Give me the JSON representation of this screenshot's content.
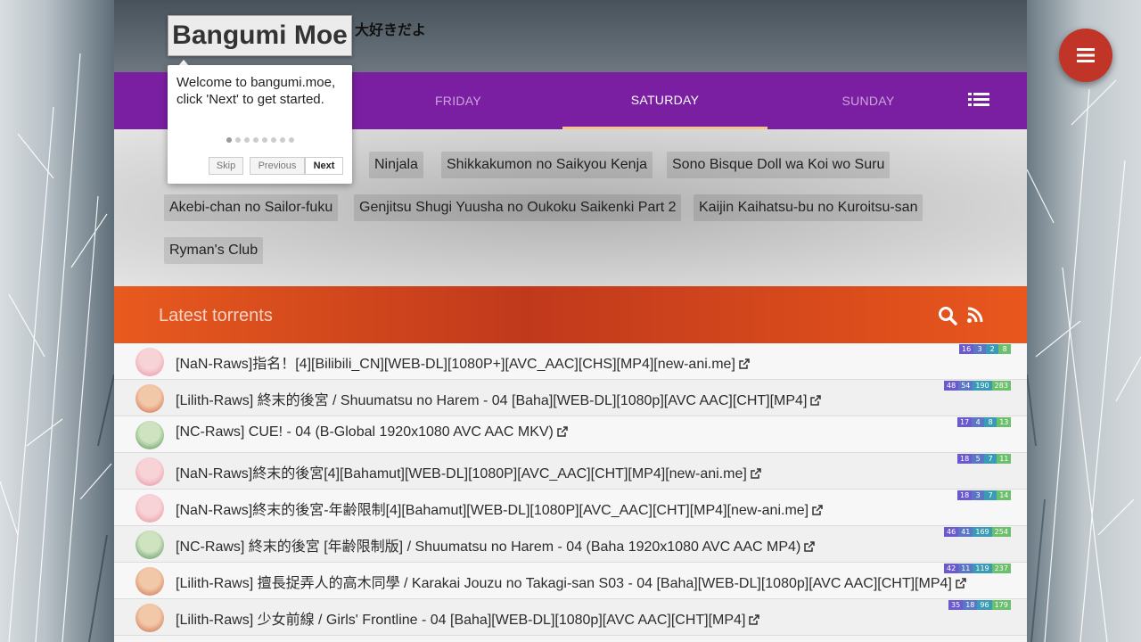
{
  "brand": {
    "logo_text": "Bangumi Moe",
    "tagline": "大好きだよ"
  },
  "days": [
    {
      "label": "FRIDAY",
      "active": false
    },
    {
      "label": "SATURDAY",
      "active": true
    },
    {
      "label": "SUNDAY",
      "active": false
    }
  ],
  "bangumi_tags": [
    "Ninjala",
    "Shikkakumon no Saikyou Kenja",
    "Sono Bisque Doll wa Koi wo Suru",
    "Akebi-chan no Sailor-fuku",
    "Genjitsu Shugi Yuusha no Oukoku Saikenki Part 2",
    "Kaijin Kaihatsu-bu no Kuroitsu-san",
    "Ryman's Club"
  ],
  "torrents": {
    "header_title": "Latest torrents",
    "rows": [
      {
        "title": "[NaN-Raws]指名！[4][Bilibili_CN][WEB-DL][1080P+][AVC_AAC][CHS][MP4][new-ani.me]",
        "avatar": "pink",
        "stats": [
          "16",
          "3",
          "2",
          "8"
        ]
      },
      {
        "title": "[Lilith-Raws] 終末的後宮 / Shuumatsu no Harem - 04 [Baha][WEB-DL][1080p][AVC AAC][CHT][MP4]",
        "avatar": "orange",
        "stats": [
          "48",
          "54",
          "190",
          "283"
        ]
      },
      {
        "title": "[NC-Raws] CUE! - 04 (B-Global 1920x1080 AVC AAC MKV)",
        "avatar": "green",
        "stats": [
          "17",
          "4",
          "8",
          "13"
        ]
      },
      {
        "title": "[NaN-Raws]終末的後宮[4][Bahamut][WEB-DL][1080P][AVC_AAC][CHT][MP4][new-ani.me]",
        "avatar": "pink",
        "stats": [
          "18",
          "5",
          "7",
          "11"
        ]
      },
      {
        "title": "[NaN-Raws]終末的後宮-年齢限制[4][Bahamut][WEB-DL][1080P][AVC_AAC][CHT][MP4][new-ani.me]",
        "avatar": "pink",
        "stats": [
          "18",
          "3",
          "7",
          "14"
        ]
      },
      {
        "title": "[NC-Raws] 終末的後宮 [年齢限制版] / Shuumatsu no Harem - 04 (Baha 1920x1080 AVC AAC MP4)",
        "avatar": "green",
        "stats": [
          "46",
          "41",
          "169",
          "254"
        ]
      },
      {
        "title": "[Lilith-Raws] 擅長捉弄人的高木同學 / Karakai Jouzu no Takagi-san S03 - 04 [Baha][WEB-DL][1080p][AVC AAC][CHT][MP4]",
        "avatar": "orange",
        "stats": [
          "42",
          "11",
          "119",
          "237"
        ]
      },
      {
        "title": "[Lilith-Raws] 少女前線 / Girls' Frontline - 04 [Baha][WEB-DL][1080p][AVC AAC][CHT][MP4]",
        "avatar": "orange",
        "stats": [
          "35",
          "18",
          "96",
          "179"
        ]
      }
    ]
  },
  "tour": {
    "text": "Welcome to bangumi.moe, click 'Next' to get started.",
    "skip_label": "Skip",
    "previous_label": "Previous",
    "next_label": "Next",
    "steps": 8,
    "current_step": 1
  },
  "colors": {
    "daybar": "#7b1fa2",
    "torrent_header": "#d2451d",
    "fab": "#c03527"
  }
}
